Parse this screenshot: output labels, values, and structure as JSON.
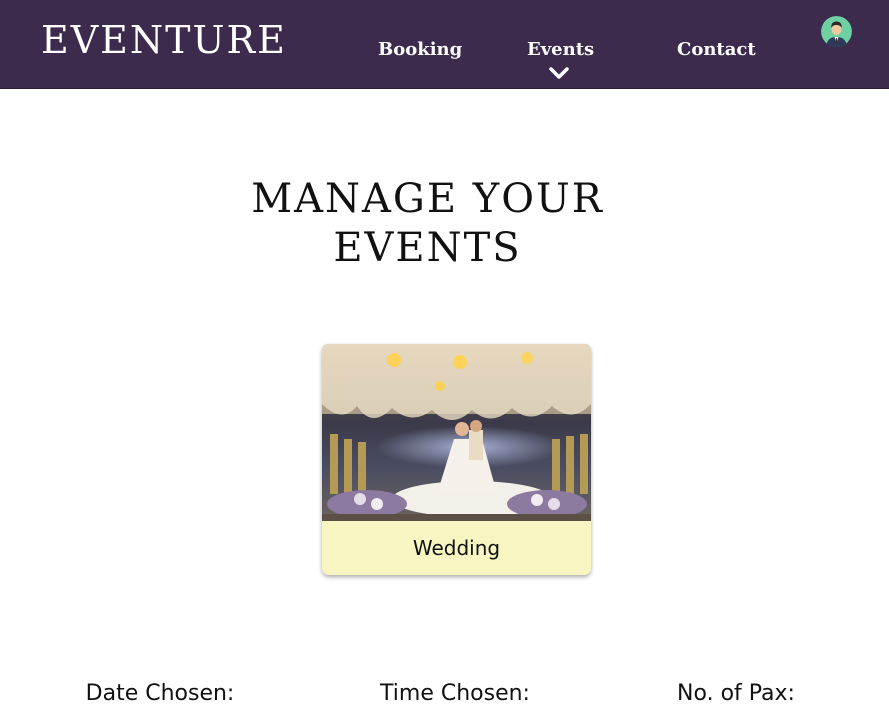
{
  "brand": {
    "name": "EVENTURE"
  },
  "nav": {
    "booking": "Booking",
    "events": "Events",
    "contact": "Contact"
  },
  "page": {
    "title_line1": "MANAGE YOUR",
    "title_line2": "EVENTS"
  },
  "event_card": {
    "label": "Wedding"
  },
  "details": {
    "date_label": "Date Chosen:",
    "time_label": "Time Chosen:",
    "pax_label": "No. of Pax:"
  },
  "colors": {
    "navbar_bg": "#3d2b4e",
    "card_label_bg": "#f7f6c3"
  },
  "icons": {
    "events_dropdown": "chevron-down-icon",
    "profile": "user-avatar-icon"
  }
}
